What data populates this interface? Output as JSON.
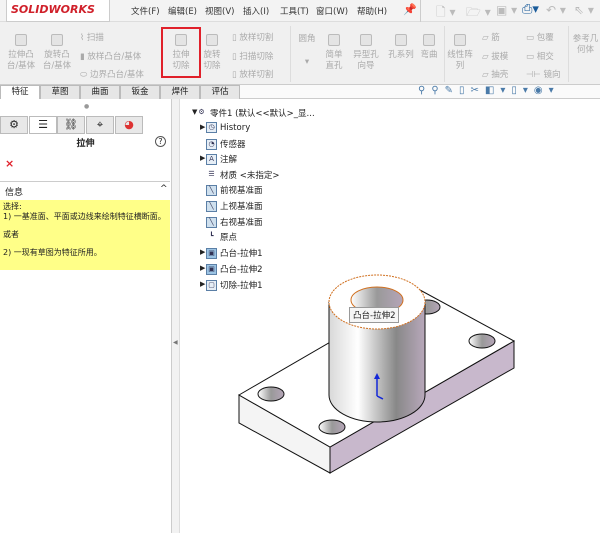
{
  "app": {
    "logo": "SOLIDWORKS"
  },
  "menu": [
    "文件(F)",
    "编辑(E)",
    "视图(V)",
    "插入(I)",
    "工具(T)",
    "窗口(W)",
    "帮助(H)"
  ],
  "ribbon": {
    "extrude_boss": "拉伸凸台/基体",
    "revolve_boss": "旋转凸台/基体",
    "sweep": "扫描",
    "loft": "放样凸台/基体",
    "boundary": "边界凸台/基体",
    "extrude_cut": "拉伸切除",
    "revolve_cut": "旋转切除",
    "loft_cut": "放样切割",
    "sweep_cut": "扫描切除",
    "boundary_cut": "放样切割",
    "fillet": "圆角",
    "simple_hole": "简单直孔",
    "hole_wizard": "异型孔向导",
    "hole_series": "孔系列",
    "flex": "弯曲",
    "linear_pattern": "线性阵列",
    "rib": "筋",
    "draft": "拔模",
    "shell": "抽壳",
    "wrap": "包覆",
    "intersect": "相交",
    "mirror": "镜向",
    "ref_geometry": "参考几何体"
  },
  "tabs": [
    "特征",
    "草图",
    "曲面",
    "钣金",
    "焊件",
    "评估"
  ],
  "panel": {
    "title": "拉伸",
    "help": "?",
    "cancel": "×",
    "section": "信息",
    "collapse": "^",
    "info": [
      "选择:",
      "1) 一基准面、平面或边线来绘制特征横断面。",
      "或者",
      "2) 一现有草图为特征所用。"
    ]
  },
  "tree": {
    "root": "零件1 (默认<<默认>_显...",
    "items": [
      "History",
      "传感器",
      "注解",
      "材质 <未指定>",
      "前视基准面",
      "上视基准面",
      "右视基准面",
      "原点",
      "凸台-拉伸1",
      "凸台-拉伸2",
      "切除-拉伸1"
    ]
  },
  "tooltip": "凸台-拉伸2",
  "colors": {
    "highlight": "#e0202a",
    "info_bg": "#ffff88",
    "side_face": "#c8b8cc"
  }
}
